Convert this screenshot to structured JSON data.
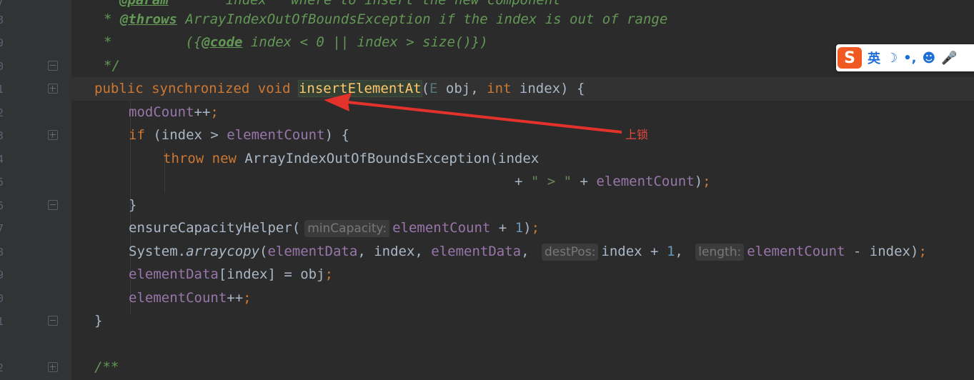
{
  "line_numbers": [
    "7",
    "8",
    "9",
    "0",
    "1",
    "2",
    "3",
    "4",
    "5",
    "6",
    "7",
    "8",
    "9",
    "0",
    "1",
    "2"
  ],
  "code": {
    "l0_tag": "@param",
    "l0_text": "index   where to insert the new component",
    "l1_star": "* ",
    "l1_tag": "@throws",
    "l1_text": " ArrayIndexOutOfBoundsException if the index is out of range",
    "l2_star": "*         ({",
    "l2_tag": "@code",
    "l2_text": " index < 0 || index > size()})",
    "l3": "*/",
    "l4_kw": "public synchronized void ",
    "l4_fn": "insertElementAt",
    "l4_p1": "(",
    "l4_generic": "E",
    "l4_p2": " obj, ",
    "l4_int": "int",
    "l4_p3": " index) {",
    "l5_fld": "modCount",
    "l5_rest": "++",
    "l5_semi": ";",
    "l6_kw": "if",
    "l6_a": " (index > ",
    "l6_fld": "elementCount",
    "l6_b": ") {",
    "l7_kw": "throw new",
    "l7_rest": " ArrayIndexOutOfBoundsException(index",
    "l8_a": "+ ",
    "l8_str": "\" > \"",
    "l8_b": " + ",
    "l8_fld": "elementCount",
    "l8_c": ")",
    "l8_semi": ";",
    "l9": "}",
    "l10_a": "ensureCapacityHelper(",
    "l10_hint": "minCapacity:",
    "l10_fld": "elementCount",
    "l10_b": " + ",
    "l10_num": "1",
    "l10_c": ")",
    "l10_semi": ";",
    "l11_a": "System.",
    "l11_it": "arraycopy",
    "l11_b": "(",
    "l11_f1": "elementData",
    "l11_c": ", index, ",
    "l11_f2": "elementData",
    "l11_d": ", ",
    "l11_hint1": "destPos:",
    "l11_e": "index + ",
    "l11_num": "1",
    "l11_f": ", ",
    "l11_hint2": "length:",
    "l11_f3": "elementCount",
    "l11_g": " - index)",
    "l11_semi": ";",
    "l12_fld": "elementData",
    "l12_a": "[index] = obj",
    "l12_semi": ";",
    "l13_fld": "elementCount",
    "l13_a": "++",
    "l13_semi": ";",
    "l14": "}",
    "l15": "/**"
  },
  "annotation": {
    "text": "上锁",
    "color": "#e84a3c"
  },
  "ime": {
    "logo": "S",
    "lang": "英",
    "moon": "☽",
    "punct": "•,",
    "emoji": "☻",
    "mic": "🎤"
  },
  "colors": {
    "keyword": "#cc7832",
    "field": "#9876aa",
    "number": "#6897bb",
    "string": "#6a8759",
    "function": "#ffc66d",
    "doc": "#629755",
    "background": "#2b2b2b"
  }
}
